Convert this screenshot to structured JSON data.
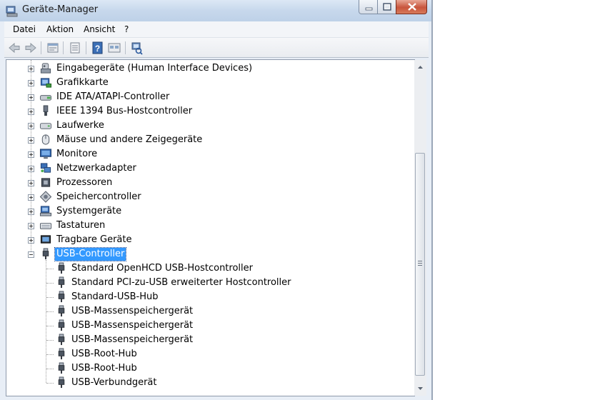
{
  "window": {
    "title": "Geräte-Manager",
    "colors": {
      "titlebar": "#c7d8ec",
      "selection": "#3399ff",
      "close": "#c8553d"
    }
  },
  "menu": [
    {
      "label": "Datei"
    },
    {
      "label": "Aktion"
    },
    {
      "label": "Ansicht"
    },
    {
      "label": "?"
    }
  ],
  "toolbar": {
    "buttons": [
      "back-icon",
      "forward-icon",
      "computer-view-icon",
      "properties-icon",
      "help-icon",
      "device-view-icon",
      "scan-hardware-icon"
    ]
  },
  "tree": {
    "categories": [
      {
        "label": "Eingabegeräte (Human Interface Devices)",
        "icon": "hid-icon"
      },
      {
        "label": "Grafikkarte",
        "icon": "display-adapter-icon"
      },
      {
        "label": "IDE ATA/ATAPI-Controller",
        "icon": "ide-controller-icon"
      },
      {
        "label": "IEEE 1394 Bus-Hostcontroller",
        "icon": "firewire-icon"
      },
      {
        "label": "Laufwerke",
        "icon": "disk-drive-icon"
      },
      {
        "label": "Mäuse und andere Zeigegeräte",
        "icon": "mouse-icon"
      },
      {
        "label": "Monitore",
        "icon": "monitor-icon"
      },
      {
        "label": "Netzwerkadapter",
        "icon": "network-adapter-icon"
      },
      {
        "label": "Prozessoren",
        "icon": "processor-icon"
      },
      {
        "label": "Speichercontroller",
        "icon": "storage-controller-icon"
      },
      {
        "label": "Systemgeräte",
        "icon": "system-devices-icon"
      },
      {
        "label": "Tastaturen",
        "icon": "keyboard-icon"
      },
      {
        "label": "Tragbare Geräte",
        "icon": "portable-devices-icon"
      }
    ],
    "expanded": {
      "label": "USB-Controller",
      "icon": "usb-plug-icon",
      "children": [
        "Standard OpenHCD USB-Hostcontroller",
        "Standard PCI-zu-USB erweiterter Hostcontroller",
        "Standard-USB-Hub",
        "USB-Massenspeichergerät",
        "USB-Massenspeichergerät",
        "USB-Massenspeichergerät",
        "USB-Root-Hub",
        "USB-Root-Hub",
        "USB-Verbundgerät"
      ]
    }
  }
}
